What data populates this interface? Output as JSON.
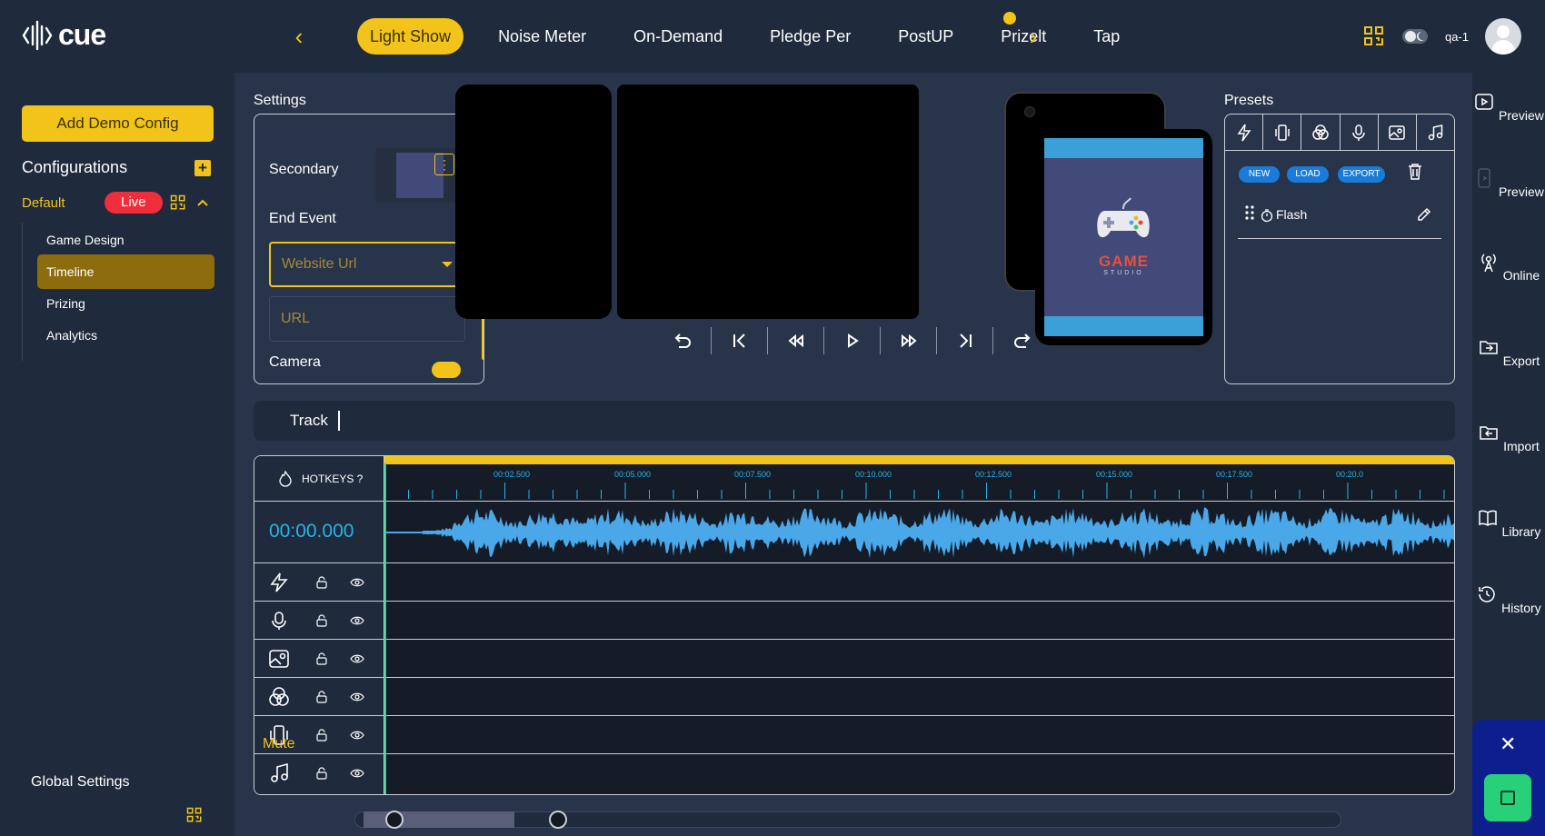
{
  "app": {
    "logo_text": "cue"
  },
  "header": {
    "tabs": [
      {
        "label": "Light Show",
        "active": true
      },
      {
        "label": "Noise Meter"
      },
      {
        "label": "On-Demand"
      },
      {
        "label": "Pledge Per"
      },
      {
        "label": "PostUP"
      },
      {
        "label": "Prizelt"
      },
      {
        "label": "Tap"
      }
    ],
    "user": "qa-1"
  },
  "sidebar": {
    "add_demo": "Add Demo Config",
    "configurations_title": "Configurations",
    "default_label": "Default",
    "live_badge": "Live",
    "items": [
      {
        "label": "Game Design"
      },
      {
        "label": "Timeline",
        "active": true
      },
      {
        "label": "Prizing"
      },
      {
        "label": "Analytics"
      }
    ],
    "global_settings": "Global Settings"
  },
  "settings": {
    "title": "Settings",
    "secondary_label": "Secondary",
    "end_event_label": "End Event",
    "end_event_value": "Website Url",
    "url_placeholder": "URL",
    "camera_label": "Camera"
  },
  "preview": {
    "game_text": "GAME",
    "studio_text": "STUDIO"
  },
  "presets": {
    "title": "Presets",
    "new": "NEW",
    "load": "LOAD",
    "export": "EXPORT",
    "items": [
      {
        "label": "Flash"
      }
    ]
  },
  "track": {
    "label": "Track"
  },
  "timeline": {
    "hotkeys_label": "HOTKEYS ?",
    "timecode": "00:00.000",
    "ticks": [
      "00:02.500",
      "00:05.000",
      "00:07.500",
      "00:10.000",
      "00:12.500",
      "00:15.000",
      "00:17.500",
      "00:20.0"
    ],
    "mute_label": "Mute",
    "zoom_level": 0.15
  },
  "rail": {
    "items": [
      {
        "label": "Preview",
        "icon": "preview-icon"
      },
      {
        "label": "Preview",
        "icon": "phone-preview-icon"
      },
      {
        "label": "Online",
        "icon": "broadcast-icon"
      },
      {
        "label": "Export",
        "icon": "export-icon"
      },
      {
        "label": "Import",
        "icon": "import-icon"
      },
      {
        "label": "Library",
        "icon": "book-icon"
      },
      {
        "label": "History",
        "icon": "history-icon"
      }
    ]
  },
  "colors": {
    "accent": "#f2c318",
    "live": "#ee2e3c",
    "timecode": "#27b4e8",
    "wave": "#4aa7e8",
    "playhead": "#2dd48c"
  }
}
